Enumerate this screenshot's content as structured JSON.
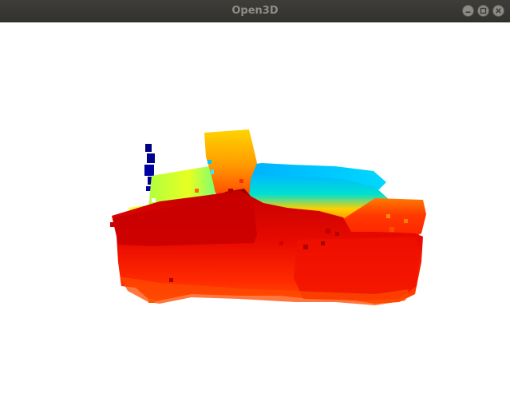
{
  "window": {
    "title": "Open3D"
  },
  "controls": {
    "minimize_icon": "minimize-icon",
    "maximize_icon": "maximize-icon",
    "close_icon": "close-icon"
  },
  "viewport": {
    "background": "#ffffff",
    "colormap": "jet",
    "colors": {
      "near": "#d40000",
      "mid": "#ffdd00",
      "far": "#00a0ff",
      "farthest": "#00007a"
    }
  }
}
